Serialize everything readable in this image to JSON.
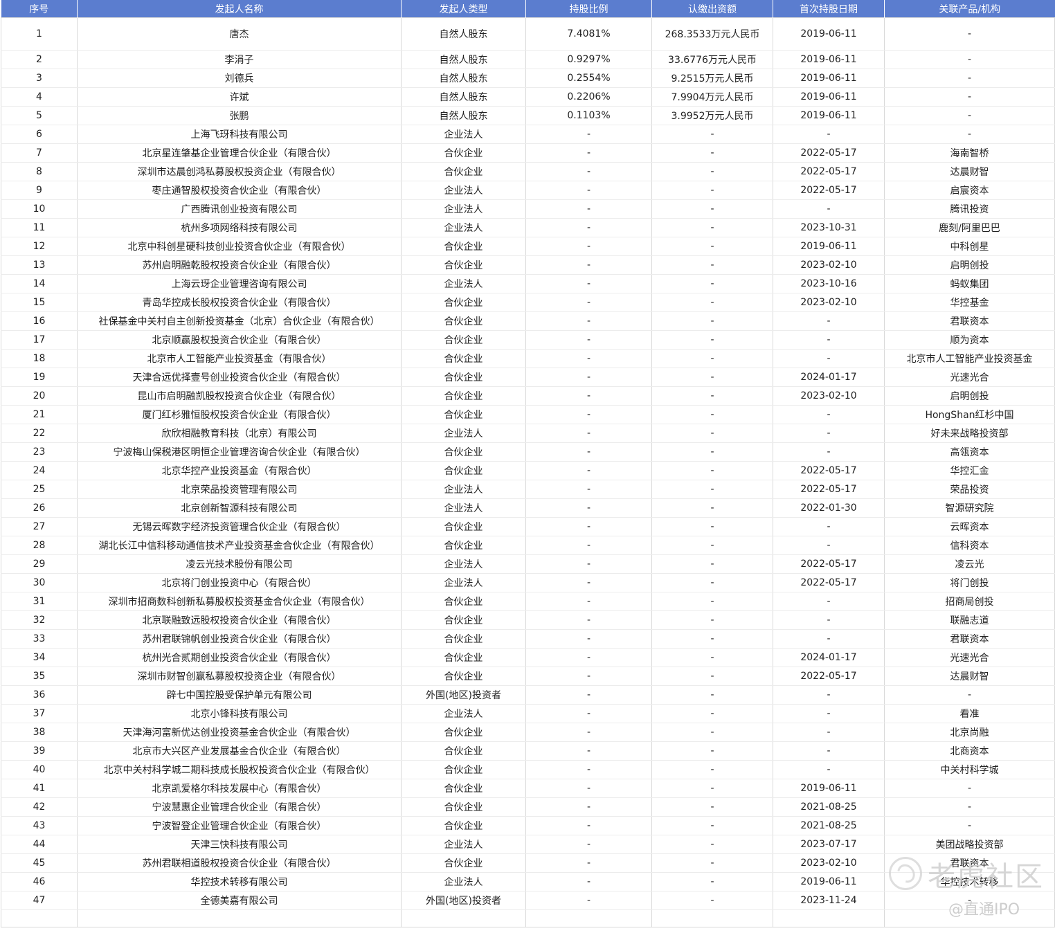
{
  "headers": [
    "序号",
    "发起人名称",
    "发起人类型",
    "持股比例",
    "认缴出资额",
    "首次持股日期",
    "关联产品/机构"
  ],
  "rows": [
    [
      "1",
      "唐杰",
      "自然人股东",
      "7.4081%",
      "268.3533万元人民币",
      "2019-06-11",
      "-"
    ],
    [
      "2",
      "李涓子",
      "自然人股东",
      "0.9297%",
      "33.6776万元人民币",
      "2019-06-11",
      "-"
    ],
    [
      "3",
      "刘德兵",
      "自然人股东",
      "0.2554%",
      "9.2515万元人民币",
      "2019-06-11",
      "-"
    ],
    [
      "4",
      "许斌",
      "自然人股东",
      "0.2206%",
      "7.9904万元人民币",
      "2019-06-11",
      "-"
    ],
    [
      "5",
      "张鹏",
      "自然人股东",
      "0.1103%",
      "3.9952万元人民币",
      "2019-06-11",
      "-"
    ],
    [
      "6",
      "上海飞玡科技有限公司",
      "企业法人",
      "-",
      "-",
      "-",
      "-"
    ],
    [
      "7",
      "北京星连肇基企业管理合伙企业（有限合伙）",
      "合伙企业",
      "-",
      "-",
      "2022-05-17",
      "海南智桥"
    ],
    [
      "8",
      "深圳市达晨创鸿私募股权投资企业（有限合伙）",
      "合伙企业",
      "-",
      "-",
      "2022-05-17",
      "达晨财智"
    ],
    [
      "9",
      "枣庄通智股权投资合伙企业（有限合伙）",
      "企业法人",
      "-",
      "-",
      "2022-05-17",
      "启宸资本"
    ],
    [
      "10",
      "广西腾讯创业投资有限公司",
      "企业法人",
      "-",
      "-",
      "-",
      "腾讯投资"
    ],
    [
      "11",
      "杭州多项网络科技有限公司",
      "企业法人",
      "-",
      "-",
      "2023-10-31",
      "鹿刻/阿里巴巴"
    ],
    [
      "12",
      "北京中科创星硬科技创业投资合伙企业（有限合伙）",
      "合伙企业",
      "-",
      "-",
      "2019-06-11",
      "中科创星"
    ],
    [
      "13",
      "苏州启明融乾股权投资合伙企业（有限合伙）",
      "合伙企业",
      "-",
      "-",
      "2023-02-10",
      "启明创投"
    ],
    [
      "14",
      "上海云玡企业管理咨询有限公司",
      "企业法人",
      "-",
      "-",
      "2023-10-16",
      "蚂蚁集团"
    ],
    [
      "15",
      "青岛华控成长股权投资合伙企业（有限合伙）",
      "合伙企业",
      "-",
      "-",
      "2023-02-10",
      "华控基金"
    ],
    [
      "16",
      "社保基金中关村自主创新投资基金（北京）合伙企业（有限合伙）",
      "合伙企业",
      "-",
      "-",
      "-",
      "君联资本"
    ],
    [
      "17",
      "北京顺赢股权投资合伙企业（有限合伙）",
      "合伙企业",
      "-",
      "-",
      "-",
      "顺为资本"
    ],
    [
      "18",
      "北京市人工智能产业投资基金（有限合伙）",
      "合伙企业",
      "-",
      "-",
      "-",
      "北京市人工智能产业投资基金"
    ],
    [
      "19",
      "天津合远优择壹号创业投资合伙企业（有限合伙）",
      "合伙企业",
      "-",
      "-",
      "2024-01-17",
      "光速光合"
    ],
    [
      "20",
      "昆山市启明融凯股权投资合伙企业（有限合伙）",
      "合伙企业",
      "-",
      "-",
      "2023-02-10",
      "启明创投"
    ],
    [
      "21",
      "厦门红杉雅恒股权投资合伙企业（有限合伙）",
      "合伙企业",
      "-",
      "-",
      "-",
      "HongShan红杉中国"
    ],
    [
      "22",
      "欣欣相融教育科技（北京）有限公司",
      "企业法人",
      "-",
      "-",
      "-",
      "好未来战略投资部"
    ],
    [
      "23",
      "宁波梅山保税港区明恒企业管理咨询合伙企业（有限合伙）",
      "合伙企业",
      "-",
      "-",
      "-",
      "高瓴资本"
    ],
    [
      "24",
      "北京华控产业投资基金（有限合伙）",
      "合伙企业",
      "-",
      "-",
      "2022-05-17",
      "华控汇金"
    ],
    [
      "25",
      "北京荣品投资管理有限公司",
      "企业法人",
      "-",
      "-",
      "2022-05-17",
      "荣品投资"
    ],
    [
      "26",
      "北京创新智源科技有限公司",
      "企业法人",
      "-",
      "-",
      "2022-01-30",
      "智源研究院"
    ],
    [
      "27",
      "无锡云晖数字经济投资管理合伙企业（有限合伙）",
      "合伙企业",
      "-",
      "-",
      "-",
      "云晖资本"
    ],
    [
      "28",
      "湖北长江中信科移动通信技术产业投资基金合伙企业（有限合伙）",
      "合伙企业",
      "-",
      "-",
      "-",
      "信科资本"
    ],
    [
      "29",
      "凌云光技术股份有限公司",
      "企业法人",
      "-",
      "-",
      "2022-05-17",
      "凌云光"
    ],
    [
      "30",
      "北京将门创业投资中心（有限合伙）",
      "企业法人",
      "-",
      "-",
      "2022-05-17",
      "将门创投"
    ],
    [
      "31",
      "深圳市招商数科创新私募股权投资基金合伙企业（有限合伙）",
      "合伙企业",
      "-",
      "-",
      "-",
      "招商局创投"
    ],
    [
      "32",
      "北京联融致远股权投资合伙企业（有限合伙）",
      "合伙企业",
      "-",
      "-",
      "-",
      "联融志道"
    ],
    [
      "33",
      "苏州君联锦帆创业投资合伙企业（有限合伙）",
      "合伙企业",
      "-",
      "-",
      "-",
      "君联资本"
    ],
    [
      "34",
      "杭州光合贰期创业投资合伙企业（有限合伙）",
      "合伙企业",
      "-",
      "-",
      "2024-01-17",
      "光速光合"
    ],
    [
      "35",
      "深圳市财智创赢私募股权投资企业（有限合伙）",
      "合伙企业",
      "-",
      "-",
      "2022-05-17",
      "达晨财智"
    ],
    [
      "36",
      "辟七中国控股受保护单元有限公司",
      "外国(地区)投资者",
      "-",
      "-",
      "-",
      "-"
    ],
    [
      "37",
      "北京小锋科技有限公司",
      "企业法人",
      "-",
      "-",
      "-",
      "看准"
    ],
    [
      "38",
      "天津海河富新优达创业投资基金合伙企业（有限合伙）",
      "合伙企业",
      "-",
      "-",
      "-",
      "北京尚融"
    ],
    [
      "39",
      "北京市大兴区产业发展基金合伙企业（有限合伙）",
      "合伙企业",
      "-",
      "-",
      "-",
      "北商资本"
    ],
    [
      "40",
      "北京中关村科学城二期科技成长股权投资合伙企业（有限合伙）",
      "合伙企业",
      "-",
      "-",
      "-",
      "中关村科学城"
    ],
    [
      "41",
      "北京凯爱格尔科技发展中心（有限合伙）",
      "合伙企业",
      "-",
      "-",
      "2019-06-11",
      "-"
    ],
    [
      "42",
      "宁波慧惠企业管理合伙企业（有限合伙）",
      "合伙企业",
      "-",
      "-",
      "2021-08-25",
      "-"
    ],
    [
      "43",
      "宁波智登企业管理合伙企业（有限合伙）",
      "合伙企业",
      "-",
      "-",
      "2021-08-25",
      "-"
    ],
    [
      "44",
      "天津三快科技有限公司",
      "企业法人",
      "-",
      "-",
      "2023-07-17",
      "美团战略投资部"
    ],
    [
      "45",
      "苏州君联相道股权投资合伙企业（有限合伙）",
      "合伙企业",
      "-",
      "-",
      "2023-02-10",
      "君联资本"
    ],
    [
      "46",
      "华控技术转移有限公司",
      "企业法人",
      "-",
      "-",
      "2019-06-11",
      "华控技术转移"
    ],
    [
      "47",
      "全德美嘉有限公司",
      "外国(地区)投资者",
      "-",
      "-",
      "2023-11-24",
      "-"
    ]
  ],
  "watermark": {
    "text": "老虎社区",
    "sub": "@直通IPO"
  },
  "colors": {
    "header_bg": "#5b7dcf",
    "header_text": "#ffffff"
  }
}
